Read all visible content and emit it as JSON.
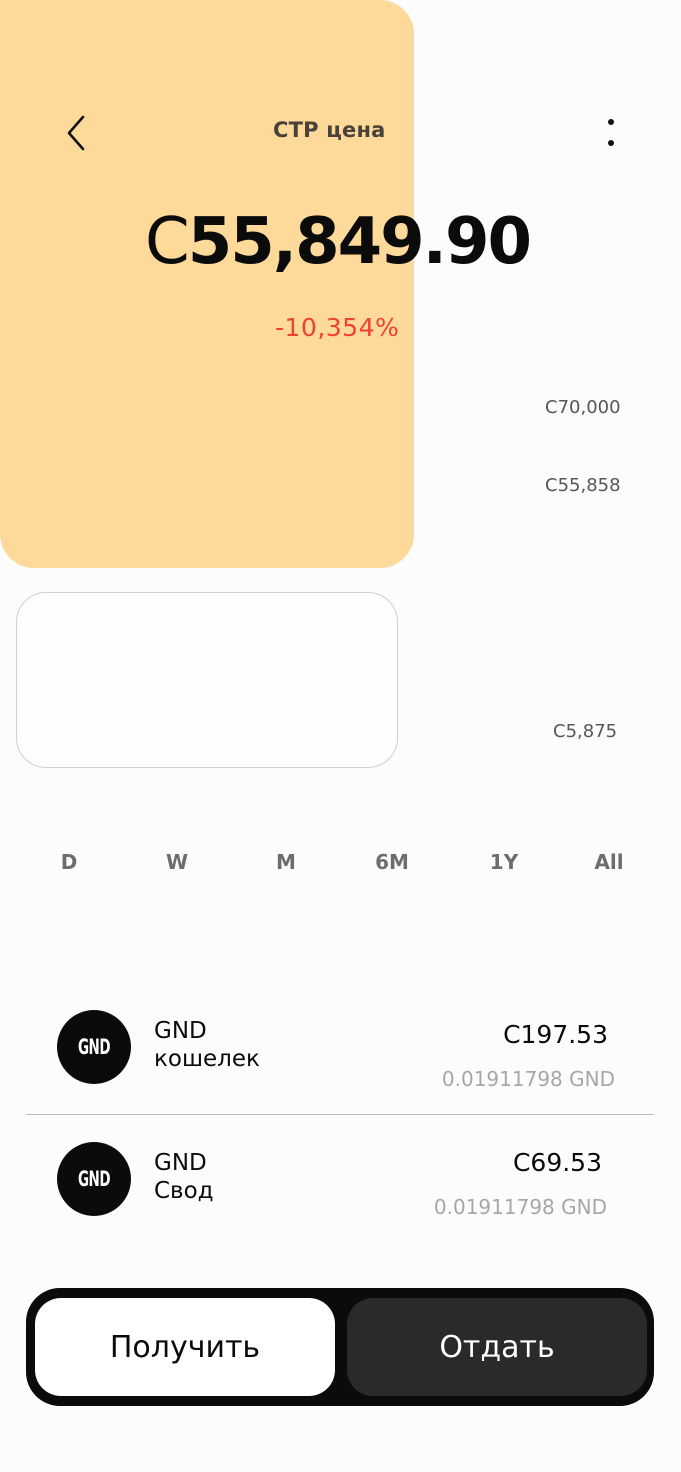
{
  "header": {
    "title": "СТР цена",
    "back_icon": "chevron-left-icon",
    "more_icon": "more-vertical-icon"
  },
  "price": {
    "currency_symbol": "C",
    "value": "55,849.90",
    "change": "-10,354%"
  },
  "chart": {
    "labels": [
      "C70,000",
      "C55,858",
      "C5,875"
    ]
  },
  "periods": [
    "D",
    "W",
    "M",
    "6M",
    "1Y",
    "All"
  ],
  "assets": [
    {
      "logo_text": "GND",
      "name_line1": "GND",
      "name_line2": "кошелек",
      "fiat": "C197.53",
      "crypto": "0.01911798 GND"
    },
    {
      "logo_text": "GND",
      "name_line1": "GND",
      "name_line2": "Свод",
      "fiat": "C69.53",
      "crypto": "0.01911798 GND"
    }
  ],
  "actions": {
    "receive_label": "Получить",
    "send_label": "Отдать"
  },
  "colors": {
    "hero_bg": "#fdd99a",
    "negative": "#f0432d",
    "dark": "#0b0b0b",
    "send_bg": "#2a2a2a"
  }
}
